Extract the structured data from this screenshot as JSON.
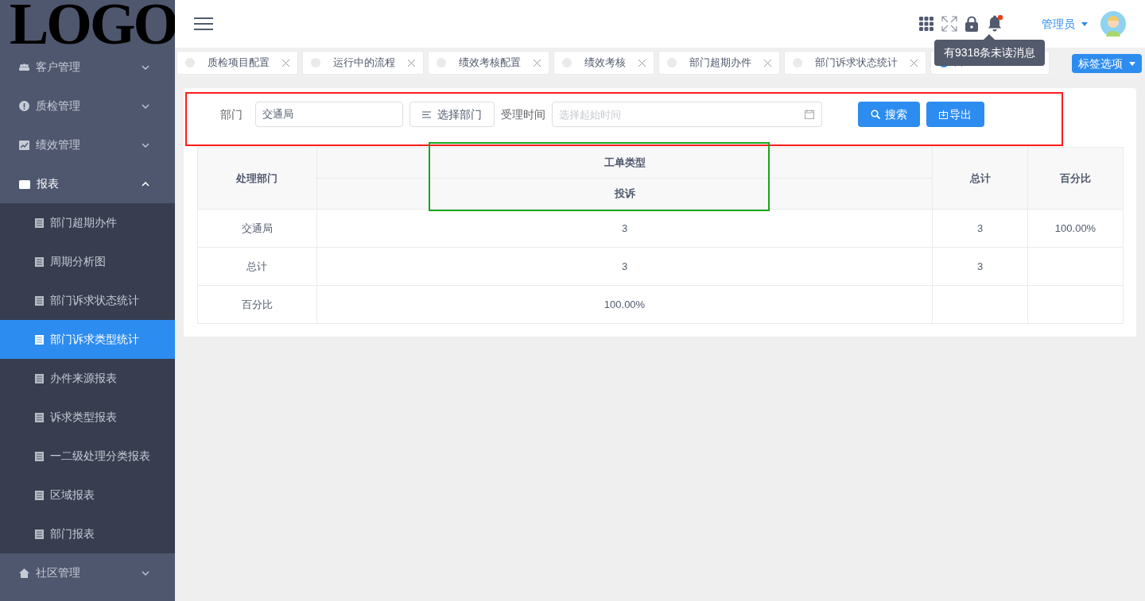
{
  "logo": {
    "text": "LOGO"
  },
  "sidebar": {
    "items": [
      {
        "label": "客户管理",
        "expanded": false
      },
      {
        "label": "质检管理",
        "expanded": false
      },
      {
        "label": "绩效管理",
        "expanded": false
      },
      {
        "label": "报表",
        "expanded": true,
        "children": [
          {
            "label": "部门超期办件",
            "selected": false
          },
          {
            "label": "周期分析图",
            "selected": false
          },
          {
            "label": "部门诉求状态统计",
            "selected": false
          },
          {
            "label": "部门诉求类型统计",
            "selected": true
          },
          {
            "label": "办件来源报表",
            "selected": false
          },
          {
            "label": "诉求类型报表",
            "selected": false
          },
          {
            "label": "一二级处理分类报表",
            "selected": false
          },
          {
            "label": "区域报表",
            "selected": false
          },
          {
            "label": "部门报表",
            "selected": false
          }
        ]
      },
      {
        "label": "社区管理",
        "expanded": false
      }
    ]
  },
  "header": {
    "user": "管理员",
    "has_unread": true,
    "tooltip": "有9318条未读消息"
  },
  "tabs": [
    {
      "label": "质检项目配置",
      "selected": false
    },
    {
      "label": "运行中的流程",
      "selected": false
    },
    {
      "label": "绩效考核配置",
      "selected": false
    },
    {
      "label": "绩效考核",
      "selected": false
    },
    {
      "label": "部门超期办件",
      "selected": false
    },
    {
      "label": "部门诉求状态统计",
      "selected": false
    },
    {
      "selected": true
    }
  ],
  "tab_menu": "标签选项",
  "filters": {
    "department_label": "部门",
    "department_value": "交通局",
    "choose_button": "选择部门",
    "time_label": "受理时间",
    "time_placeholder": "选择起始时间",
    "search_button": "搜索",
    "export_button": "导出"
  },
  "table": {
    "header_dept": "处理部门",
    "header_group": "工单类型",
    "header_sub": "投诉",
    "header_total": "总计",
    "header_percent": "百分比",
    "rows": [
      {
        "cells": [
          "交通局",
          "3",
          "3",
          "100.00%"
        ]
      },
      {
        "cells": [
          "总计",
          "3",
          "3",
          ""
        ]
      },
      {
        "cells": [
          "百分比",
          "100.00%",
          "",
          ""
        ]
      }
    ]
  },
  "highlights": [
    {
      "kind": "filters",
      "color": "#ff1a1a"
    },
    {
      "kind": "table",
      "color": "#1aa51a"
    }
  ]
}
